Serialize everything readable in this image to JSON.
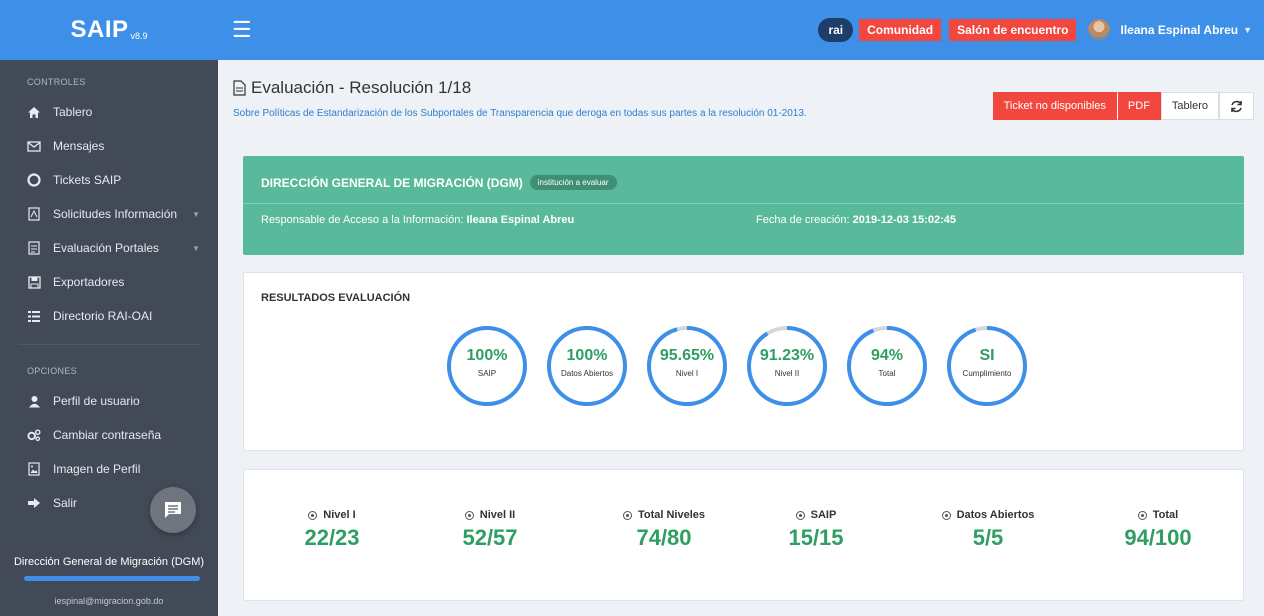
{
  "brand": {
    "name": "SAIP",
    "version": "v8.9"
  },
  "topbar": {
    "rai_label": "rai",
    "comunidad_label": "Comunidad",
    "salon_label": "Salón de encuentro",
    "user_name": "Ileana Espinal Abreu"
  },
  "sidebar": {
    "controles_title": "CONTROLES",
    "items": [
      {
        "label": "Tablero",
        "icon": "home-icon"
      },
      {
        "label": "Mensajes",
        "icon": "envelope-icon"
      },
      {
        "label": "Tickets SAIP",
        "icon": "lifebuoy-icon"
      },
      {
        "label": "Solicitudes Información",
        "icon": "pdf-file-icon"
      },
      {
        "label": "Evaluación Portales",
        "icon": "document-icon"
      },
      {
        "label": "Exportadores",
        "icon": "save-icon"
      },
      {
        "label": "Directorio RAI-OAI",
        "icon": "list-icon"
      }
    ],
    "opciones_title": "OPCIONES",
    "options": [
      {
        "label": "Perfil de usuario",
        "icon": "user-icon"
      },
      {
        "label": "Cambiar contraseña",
        "icon": "gears-icon"
      },
      {
        "label": "Imagen de Perfil",
        "icon": "image-icon"
      },
      {
        "label": "Salir",
        "icon": "sign-out-icon"
      }
    ],
    "org_name": "Dirección General de Migración (DGM)",
    "org_email": "iespinal@migracion.gob.do"
  },
  "header": {
    "title": "Evaluación - Resolución 1/18",
    "subtitle": "Sobre Políticas de Estandarización de los Subportales de Transparencia que deroga en todas sus partes a la resolución 01-2013.",
    "ticket_label": "Ticket no disponibles",
    "pdf_label": "PDF",
    "tablero_label": "Tablero"
  },
  "institution": {
    "name": "DIRECCIÓN GENERAL DE MIGRACIÓN (DGM)",
    "badge": "institución a evaluar",
    "responsable_label": "Responsable de Acceso a la Información:",
    "responsable_value": "Ileana Espinal Abreu",
    "fecha_label": "Fecha de creación:",
    "fecha_value": "2019-12-03 15:02:45"
  },
  "results": {
    "title": "RESULTADOS EVALUACIÓN",
    "circles": [
      {
        "value": "100%",
        "label": "SAIP",
        "fraction": 1.0
      },
      {
        "value": "100%",
        "label": "Datos Abiertos",
        "fraction": 1.0
      },
      {
        "value": "95.65%",
        "label": "Nivel I",
        "fraction": 0.9565
      },
      {
        "value": "91.23%",
        "label": "Nivel II",
        "fraction": 0.9123
      },
      {
        "value": "94%",
        "label": "Total",
        "fraction": 0.94
      },
      {
        "value": "SI",
        "label": "Cumplimiento",
        "fraction": 0.95
      }
    ]
  },
  "stats": [
    {
      "label": "Nivel I",
      "value": "22/23"
    },
    {
      "label": "Nivel II",
      "value": "52/57"
    },
    {
      "label": "Total Niveles",
      "value": "74/80"
    },
    {
      "label": "SAIP",
      "value": "15/15"
    },
    {
      "label": "Datos Abiertos",
      "value": "5/5"
    },
    {
      "label": "Total",
      "value": "94/100"
    }
  ],
  "colors": {
    "primary": "#3d8fe8",
    "sidebar": "#414a56",
    "accent_red": "#f2473f",
    "green_card": "#59b99b",
    "green_text": "#2e9e62"
  }
}
